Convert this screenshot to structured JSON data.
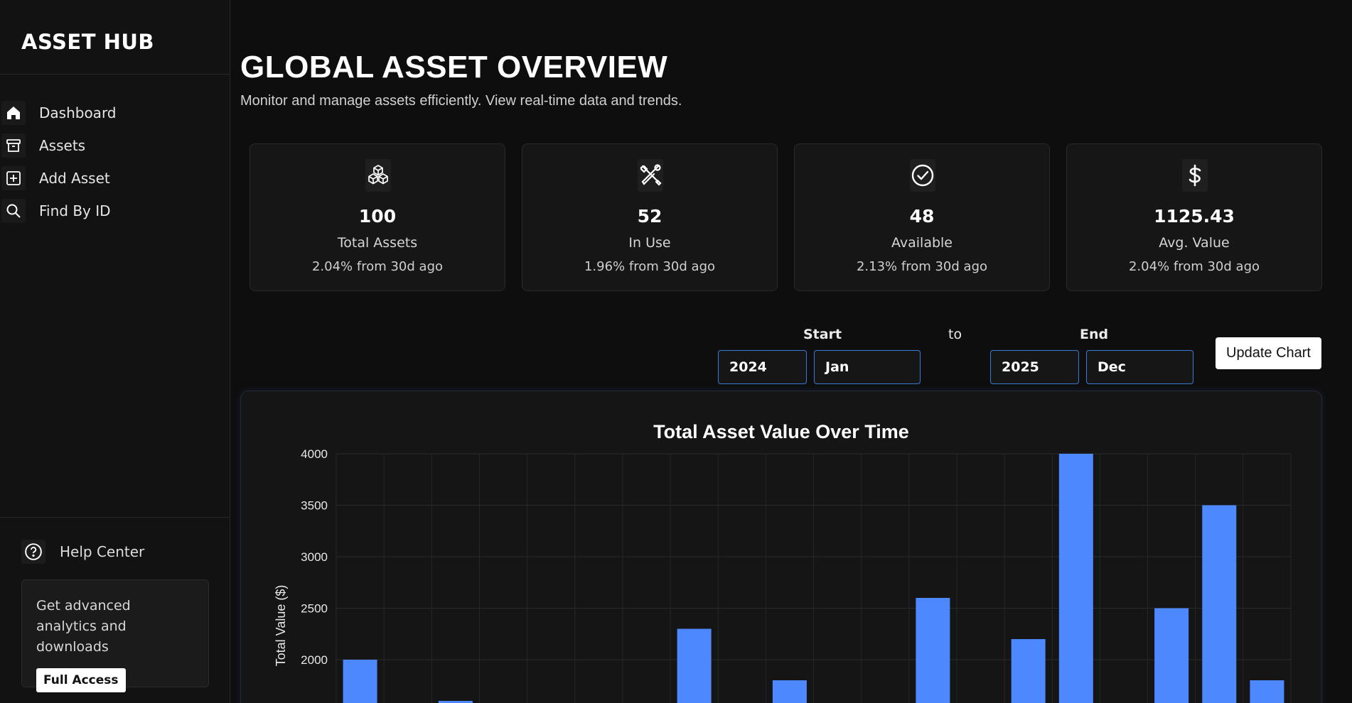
{
  "sidebar": {
    "brand": "ASSET HUB",
    "items": [
      {
        "label": "Dashboard",
        "icon": "home-icon"
      },
      {
        "label": "Assets",
        "icon": "archive-icon"
      },
      {
        "label": "Add Asset",
        "icon": "plus-square-icon"
      },
      {
        "label": "Find By ID",
        "icon": "search-icon"
      }
    ],
    "help_label": "Help Center",
    "promo": {
      "text": "Get advanced analytics and downloads",
      "button": "Full Access"
    }
  },
  "header": {
    "title": "GLOBAL ASSET OVERVIEW",
    "subtitle": "Monitor and manage assets efficiently. View real-time data and trends."
  },
  "cards": [
    {
      "icon": "cubes-icon",
      "value": "100",
      "label": "Total Assets",
      "change": "2.04% from 30d ago"
    },
    {
      "icon": "tools-icon",
      "value": "52",
      "label": "In Use",
      "change": "1.96% from 30d ago"
    },
    {
      "icon": "check-circle-icon",
      "value": "48",
      "label": "Available",
      "change": "2.13% from 30d ago"
    },
    {
      "icon": "dollar-icon",
      "value": "1125.43",
      "label": "Avg. Value",
      "change": "2.04% from 30d ago"
    }
  ],
  "range": {
    "start_label": "Start",
    "to_label": "to",
    "end_label": "End",
    "start_year": "2024",
    "start_month": "Jan",
    "end_year": "2025",
    "end_month": "Dec",
    "update_button": "Update Chart"
  },
  "colors": {
    "accent": "#4d88ff",
    "select_border": "#3a7bd5"
  },
  "chart_data": {
    "type": "bar",
    "title": "Total Asset Value Over Time",
    "xlabel": "",
    "ylabel": "Total Value ($)",
    "ylim": [
      0,
      4000
    ],
    "yticks_visible": [
      4000,
      3500,
      3000,
      2500,
      2000
    ],
    "grid": true,
    "values": [
      2000,
      0,
      1600,
      0,
      0,
      0,
      0,
      2300,
      0,
      1800,
      0,
      0,
      2600,
      0,
      2200,
      4000,
      0,
      2500,
      3500,
      1800
    ]
  }
}
